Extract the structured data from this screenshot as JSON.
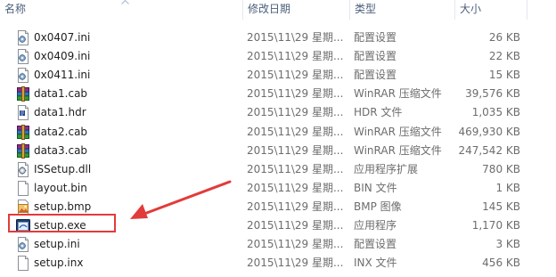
{
  "columns": {
    "name": "名称",
    "modified": "修改日期",
    "type": "类型",
    "size": "大小"
  },
  "files": [
    {
      "name": "0x0407.ini",
      "date": "2015\\11\\29 星期...",
      "type": "配置设置",
      "size": "26 KB",
      "icon": "ini-settings-icon"
    },
    {
      "name": "0x0409.ini",
      "date": "2015\\11\\29 星期...",
      "type": "配置设置",
      "size": "22 KB",
      "icon": "ini-settings-icon"
    },
    {
      "name": "0x0411.ini",
      "date": "2015\\11\\29 星期...",
      "type": "配置设置",
      "size": "15 KB",
      "icon": "ini-settings-icon"
    },
    {
      "name": "data1.cab",
      "date": "2015\\11\\29 星期...",
      "type": "WinRAR 压缩文件",
      "size": "39,576 KB",
      "icon": "winrar-archive-icon"
    },
    {
      "name": "data1.hdr",
      "date": "2015\\11\\29 星期...",
      "type": "HDR 文件",
      "size": "1,035 KB",
      "icon": "hdr-file-icon"
    },
    {
      "name": "data2.cab",
      "date": "2015\\11\\29 星期...",
      "type": "WinRAR 压缩文件",
      "size": "469,930 KB",
      "icon": "winrar-archive-icon"
    },
    {
      "name": "data3.cab",
      "date": "2015\\11\\29 星期...",
      "type": "WinRAR 压缩文件",
      "size": "247,542 KB",
      "icon": "winrar-archive-icon"
    },
    {
      "name": "ISSetup.dll",
      "date": "2015\\11\\29 星期...",
      "type": "应用程序扩展",
      "size": "780 KB",
      "icon": "dll-gear-icon"
    },
    {
      "name": "layout.bin",
      "date": "2015\\11\\29 星期...",
      "type": "BIN 文件",
      "size": "1 KB",
      "icon": "blank-file-icon"
    },
    {
      "name": "setup.bmp",
      "date": "2015\\11\\29 星期...",
      "type": "BMP 图像",
      "size": "145 KB",
      "icon": "bmp-image-icon"
    },
    {
      "name": "setup.exe",
      "date": "2015\\11\\29 星期...",
      "type": "应用程序",
      "size": "1,170 KB",
      "icon": "exe-application-icon"
    },
    {
      "name": "setup.ini",
      "date": "2015\\11\\29 星期...",
      "type": "配置设置",
      "size": "3 KB",
      "icon": "ini-settings-icon"
    },
    {
      "name": "setup.inx",
      "date": "2015\\11\\29 星期...",
      "type": "INX 文件",
      "size": "456 KB",
      "icon": "blank-file-icon"
    }
  ],
  "annotation": {
    "highlight_color": "#e23b3b"
  }
}
